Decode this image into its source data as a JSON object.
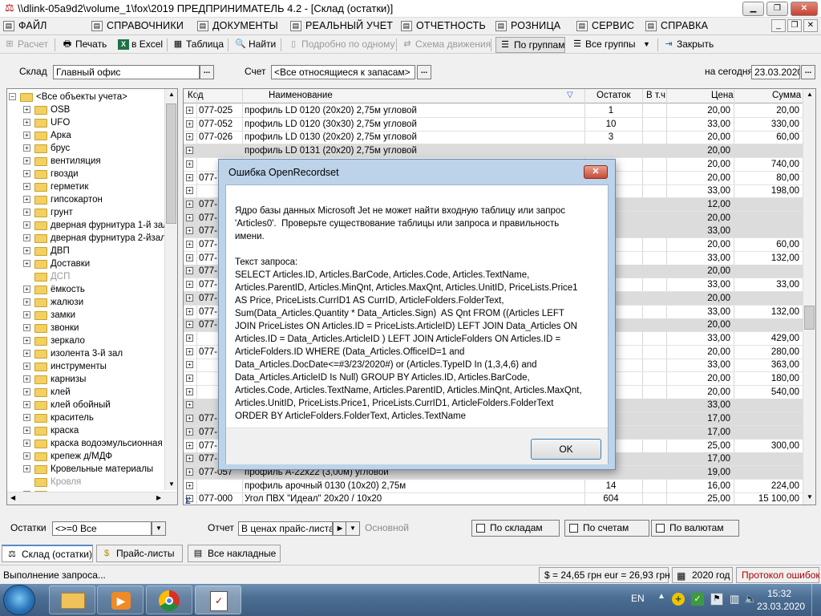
{
  "window": {
    "title": "\\\\dlink-05a9d2\\volume_1\\fox\\2019  ПРЕДПРИНИМАТЕЛЬ 4.2 - [Склад (остатки)]"
  },
  "menu": [
    "ФАЙЛ",
    "СПРАВОЧНИКИ",
    "ДОКУМЕНТЫ",
    "РЕАЛЬНЫЙ УЧЕТ",
    "ОТЧЕТНОСТЬ",
    "РОЗНИЦА",
    "СЕРВИС",
    "СПРАВКА"
  ],
  "toolbar": {
    "calc": "Расчет",
    "print": "Печать",
    "excel": "в Excel",
    "table": "Таблица",
    "find": "Найти",
    "detail": "Подробно по одному",
    "scheme": "Схема движения",
    "by_groups": "По группам",
    "all_groups": "Все группы",
    "close": "Закрыть"
  },
  "filters": {
    "warehouse_label": "Склад",
    "warehouse_value": "Главный офис",
    "account_label": "Счет",
    "account_value": "<Все относящиеся к запасам>",
    "date_label": "на сегодня",
    "date_value": "23.03.2020"
  },
  "tree": {
    "root": "<Все объекты учета>",
    "items": [
      {
        "label": "OSB",
        "gray": false
      },
      {
        "label": "UFO",
        "gray": false
      },
      {
        "label": "Арка",
        "gray": false
      },
      {
        "label": "брус",
        "gray": false
      },
      {
        "label": "вентиляция",
        "gray": false
      },
      {
        "label": "гвозди",
        "gray": false
      },
      {
        "label": "герметик",
        "gray": false
      },
      {
        "label": "гипсокартон",
        "gray": false
      },
      {
        "label": "грунт",
        "gray": false
      },
      {
        "label": "дверная фурнитура 1-й зал",
        "gray": false
      },
      {
        "label": "дверная фурнитура 2-йзал",
        "gray": false
      },
      {
        "label": "ДВП",
        "gray": false
      },
      {
        "label": "Доставки",
        "gray": false
      },
      {
        "label": "ДСП",
        "gray": true
      },
      {
        "label": "ёмкость",
        "gray": false
      },
      {
        "label": "жалюзи",
        "gray": false
      },
      {
        "label": "замки",
        "gray": false
      },
      {
        "label": "звонки",
        "gray": false
      },
      {
        "label": "зеркало",
        "gray": false
      },
      {
        "label": "изолента 3-й зал",
        "gray": false
      },
      {
        "label": "инструменты",
        "gray": false
      },
      {
        "label": "карнизы",
        "gray": false
      },
      {
        "label": "клей",
        "gray": false
      },
      {
        "label": "клей обойный",
        "gray": false
      },
      {
        "label": "краситель",
        "gray": false
      },
      {
        "label": "краска",
        "gray": false
      },
      {
        "label": "краска водоэмульсионная",
        "gray": false
      },
      {
        "label": "крепеж д/МДФ",
        "gray": false
      },
      {
        "label": "Кровельные материалы",
        "gray": false
      },
      {
        "label": "Кровля",
        "gray": true
      },
      {
        "label": "лак",
        "gray": false
      }
    ]
  },
  "grid": {
    "columns": [
      "Код",
      "Наименование",
      "Остаток",
      "В т.ч",
      "Цена",
      "Сумма"
    ],
    "rows": [
      {
        "code": "077-025",
        "name": "профиль LD 0120 (20x20) 2,75м угловой",
        "qty": "1",
        "price": "20,00",
        "sum": "20,00",
        "shade": false
      },
      {
        "code": "077-052",
        "name": "профиль LD 0120 (30x30) 2,75м угловой",
        "qty": "10",
        "price": "33,00",
        "sum": "330,00",
        "shade": false
      },
      {
        "code": "077-026",
        "name": "профиль LD 0130 (20x20) 2,75м угловой",
        "qty": "3",
        "price": "20,00",
        "sum": "60,00",
        "shade": false
      },
      {
        "code": "",
        "name": "профиль LD 0131 (20x20) 2,75м угловой",
        "qty": "",
        "price": "20,00",
        "sum": "",
        "shade": true
      },
      {
        "code": "",
        "name": "",
        "qty": "",
        "price": "20,00",
        "sum": "740,00",
        "shade": false
      },
      {
        "code": "077-",
        "name": "",
        "qty": "",
        "price": "20,00",
        "sum": "80,00",
        "shade": false
      },
      {
        "code": "",
        "name": "",
        "qty": "",
        "price": "33,00",
        "sum": "198,00",
        "shade": false
      },
      {
        "code": "077-",
        "name": "",
        "qty": "",
        "price": "12,00",
        "sum": "",
        "shade": true
      },
      {
        "code": "077-",
        "name": "",
        "qty": "",
        "price": "20,00",
        "sum": "",
        "shade": true
      },
      {
        "code": "077-",
        "name": "",
        "qty": "",
        "price": "33,00",
        "sum": "",
        "shade": true
      },
      {
        "code": "077-",
        "name": "",
        "qty": "",
        "price": "20,00",
        "sum": "60,00",
        "shade": false
      },
      {
        "code": "077-",
        "name": "",
        "qty": "",
        "price": "33,00",
        "sum": "132,00",
        "shade": false
      },
      {
        "code": "077-",
        "name": "",
        "qty": "",
        "price": "20,00",
        "sum": "",
        "shade": true
      },
      {
        "code": "077-",
        "name": "",
        "qty": "",
        "price": "33,00",
        "sum": "33,00",
        "shade": false
      },
      {
        "code": "077-",
        "name": "",
        "qty": "",
        "price": "20,00",
        "sum": "",
        "shade": true
      },
      {
        "code": "077-",
        "name": "",
        "qty": "",
        "price": "33,00",
        "sum": "132,00",
        "shade": false
      },
      {
        "code": "077-",
        "name": "",
        "qty": "",
        "price": "20,00",
        "sum": "",
        "shade": true
      },
      {
        "code": "",
        "name": "",
        "qty": "",
        "price": "33,00",
        "sum": "429,00",
        "shade": false
      },
      {
        "code": "077-",
        "name": "",
        "qty": "",
        "price": "20,00",
        "sum": "280,00",
        "shade": false
      },
      {
        "code": "",
        "name": "",
        "qty": "",
        "price": "33,00",
        "sum": "363,00",
        "shade": false
      },
      {
        "code": "",
        "name": "",
        "qty": "",
        "price": "20,00",
        "sum": "180,00",
        "shade": false
      },
      {
        "code": "",
        "name": "",
        "qty": "",
        "price": "20,00",
        "sum": "540,00",
        "shade": false
      },
      {
        "code": "",
        "name": "",
        "qty": "",
        "price": "33,00",
        "sum": "",
        "shade": true
      },
      {
        "code": "077-",
        "name": "",
        "qty": "",
        "price": "17,00",
        "sum": "",
        "shade": true
      },
      {
        "code": "077-",
        "name": "",
        "qty": "",
        "price": "17,00",
        "sum": "",
        "shade": true
      },
      {
        "code": "077-",
        "name": "",
        "qty": "",
        "price": "25,00",
        "sum": "300,00",
        "shade": false
      },
      {
        "code": "077-",
        "name": "",
        "qty": "",
        "price": "17,00",
        "sum": "",
        "shade": true
      },
      {
        "code": "077-057",
        "name": "профиль А-22x22 (3,00м) угловой",
        "qty": "",
        "price": "19,00",
        "sum": "",
        "shade": true
      },
      {
        "code": "",
        "name": "профиль арочный 0130 (10x20) 2,75м",
        "qty": "14",
        "price": "16,00",
        "sum": "224,00",
        "shade": false
      },
      {
        "code": "077-000",
        "name": "Угол ПВХ \"Идеал\" 20x20 / 10x20",
        "qty": "604",
        "price": "25,00",
        "sum": "15 100,00",
        "shade": false
      }
    ]
  },
  "bottom": {
    "balance_label": "Остатки",
    "balance_value": "<>=0  Все",
    "report_label": "Отчет",
    "report_value": "В ценах прайс-листа",
    "report_hint": "Основной",
    "by_warehouses": "По складам",
    "by_accounts": "По счетам",
    "by_currencies": "По валютам"
  },
  "doc_tabs": [
    "Склад (остатки)",
    "Прайс-листы",
    "Все накладные"
  ],
  "status": {
    "left": "Выполнение запроса...",
    "rates": "$ = 24,65 грн   eur = 26,93 грн",
    "year": "2020 год",
    "log": "Протокол ошибок"
  },
  "dialog": {
    "title": "Ошибка OpenRecordset",
    "message": "Ядро базы данных Microsoft Jet не может найти входную таблицу или запрос 'Articles0'.  Проверьте существование таблицы или запроса и правильность имени.\n\nТекст запроса:\nSELECT Articles.ID, Articles.BarCode, Articles.Code, Articles.TextName, Articles.ParentID, Articles.MinQnt, Articles.MaxQnt, Articles.UnitID, PriceLists.Price1 AS Price, PriceLists.CurrID1 AS CurrID, ArticleFolders.FolderText, Sum(Data_Articles.Quantity * Data_Articles.Sign)  AS Qnt FROM ((Articles LEFT JOIN PriceListes ON Articles.ID = PriceLists.ArticleID) LEFT JOIN Data_Articles ON Articles.ID = Data_Articles.ArticleID ) LEFT JOIN ArticleFolders ON Articles.ID = ArticleFolders.ID WHERE (Data_Articles.OfficeID=1 and Data_Articles.DocDate<=#3/23/2020#) or (Articles.TypeID In (1,3,4,6) and Data_Articles.ArticleID Is Null) GROUP BY Articles.ID, Articles.BarCode, Articles.Code, Articles.TextName, Articles.ParentID, Articles.MinQnt, Articles.MaxQnt, Articles.UnitID, PriceLists.Price1, PriceLists.CurrID1, ArticleFolders.FolderText ORDER BY ArticleFolders.FolderText, Articles.TextName",
    "ok": "OK"
  },
  "taskbar": {
    "lang": "EN",
    "time": "15:32",
    "date": "23.03.2020"
  }
}
